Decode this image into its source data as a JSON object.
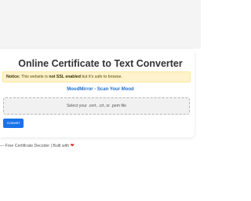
{
  "header": {
    "title": "Online Certificate to Text Converter"
  },
  "notice": {
    "label": "Notice:",
    "text_before": " This website is ",
    "ssl_text": "not SSL enabled",
    "text_after": " but it's safe to browse."
  },
  "promo": {
    "link_text": "MoodMirror - Scan Your Mood"
  },
  "upload": {
    "drop_text": "Select your .cert, .crt, or .pem file"
  },
  "actions": {
    "convert_label": "Convert"
  },
  "footer": {
    "text": "— Free Certificate Decoder | Built with ",
    "heart_icon": "heart-icon",
    "heart_color": "#d93025"
  },
  "colors": {
    "accent": "#1a73e8",
    "notice_bg": "#fff3cd",
    "link": "#1f6fd1"
  }
}
